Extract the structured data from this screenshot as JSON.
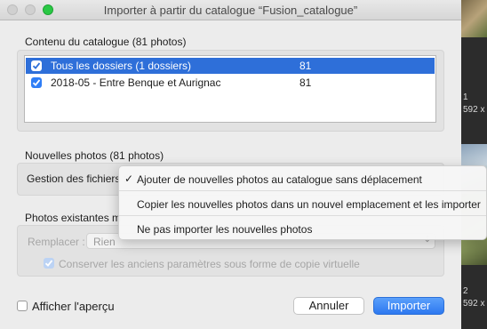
{
  "window": {
    "title": "Importer à partir du catalogue “Fusion_catalogue”"
  },
  "catalog_contents": {
    "label": "Contenu du catalogue (81 photos)",
    "rows": [
      {
        "label": "Tous les dossiers (1 dossiers)",
        "count": "81",
        "checked": true,
        "selected": true
      },
      {
        "label": "2018-05 - Entre Benque et Aurignac",
        "count": "81",
        "checked": true,
        "selected": false
      }
    ]
  },
  "new_photos": {
    "label": "Nouvelles photos (81 photos)",
    "file_handling_label": "Gestion des fichiers :"
  },
  "file_handling_menu": {
    "items": [
      {
        "label": "Ajouter de nouvelles photos au catalogue sans déplacement",
        "checked": true
      },
      {
        "label": "Copier les nouvelles photos dans un nouvel emplacement et les importer",
        "checked": false
      },
      {
        "label": "Ne pas importer les nouvelles photos",
        "checked": false
      }
    ]
  },
  "existing_photos": {
    "label": "Photos existantes m",
    "replace_label": "Remplacer :",
    "replace_value": "Rien",
    "preserve_label": "Conserver les anciens paramètres sous forme de copie virtuelle"
  },
  "footer": {
    "preview_label": "Afficher l'aperçu",
    "cancel_label": "Annuler",
    "import_label": "Importer"
  },
  "background_panel": {
    "text1": "1",
    "text2": "592 x",
    "text3": "2",
    "text4": "592 x"
  },
  "colors": {
    "accent": "#2e6fd9",
    "button_blue": "#2d78f0"
  }
}
